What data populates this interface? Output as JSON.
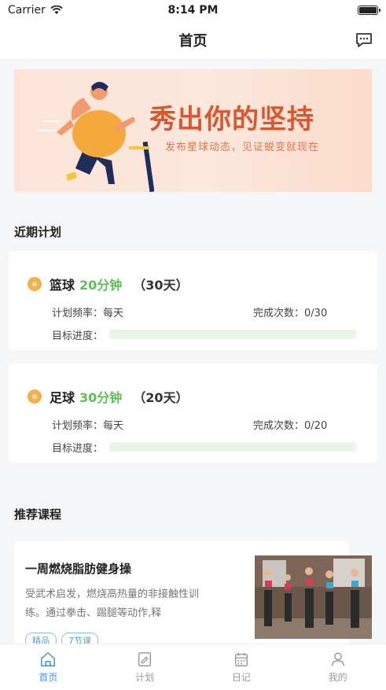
{
  "status_bar": {
    "carrier": "Carrier",
    "time": "8:14 PM"
  },
  "nav": {
    "title": "首页"
  },
  "banner": {
    "headline": "秀出你的坚持",
    "subtitle": "发布星球动态，见证蜕变就现在"
  },
  "sections": {
    "recent_plans": "近期计划",
    "recommended": "推荐课程"
  },
  "plans": [
    {
      "name": "篮球",
      "minutes": "20分钟",
      "days": "（30天）",
      "freq_label": "计划频率：",
      "freq_value": "每天",
      "count_label": "完成次数：",
      "count_value": "0/30",
      "progress_label": "目标进度：",
      "progress": 0
    },
    {
      "name": "足球",
      "minutes": "30分钟",
      "days": "（20天）",
      "freq_label": "计划频率：",
      "freq_value": "每天",
      "count_label": "完成次数：",
      "count_value": "0/20",
      "progress_label": "目标进度：",
      "progress": 0
    }
  ],
  "course": {
    "title": "一周燃烧脂肪健身操",
    "desc": "受武术启发，燃烧高热量的非接触性训练。通过拳击、踢腿等动作,释",
    "tags": [
      "精品",
      "7节课"
    ]
  },
  "tabs": [
    {
      "label": "首页",
      "icon": "home-icon"
    },
    {
      "label": "计划",
      "icon": "plan-icon"
    },
    {
      "label": "日记",
      "icon": "calendar-icon"
    },
    {
      "label": "我的",
      "icon": "person-icon"
    }
  ],
  "colors": {
    "accent": "#4a90d9",
    "green": "#5cbf58",
    "banner_text": "#d9562f"
  }
}
